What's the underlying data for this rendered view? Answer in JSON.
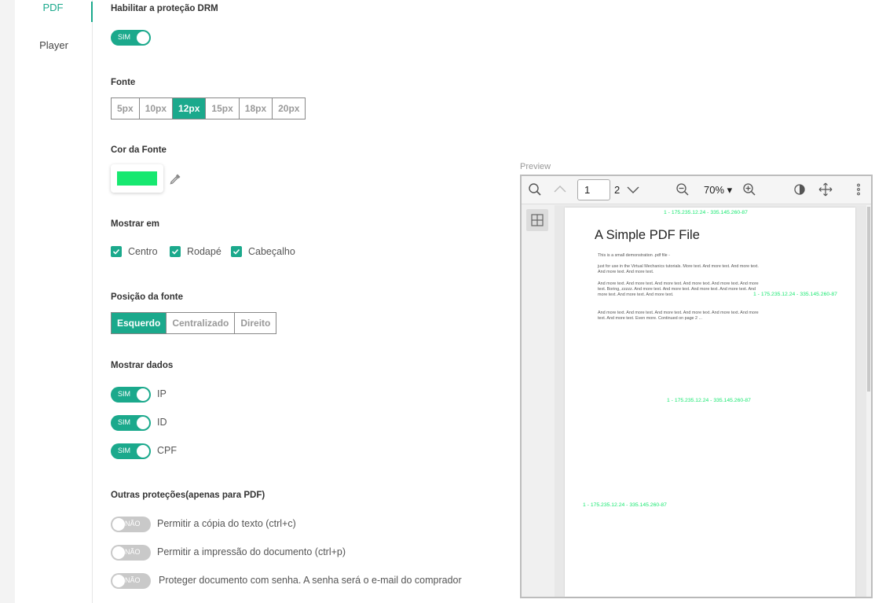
{
  "sidebar": {
    "tabs": [
      {
        "label": "PDF",
        "active": true
      },
      {
        "label": "Player",
        "active": false
      }
    ]
  },
  "drm": {
    "label": "Habilitar a proteção DRM",
    "toggle": "SIM"
  },
  "font_size": {
    "label": "Fonte",
    "options": [
      "5px",
      "10px",
      "12px",
      "15px",
      "18px",
      "20px"
    ],
    "selected": "12px"
  },
  "font_color": {
    "label": "Cor da Fonte",
    "value": "#17e870"
  },
  "show_in": {
    "label": "Mostrar em",
    "options": [
      "Centro",
      "Rodapé",
      "Cabeçalho"
    ]
  },
  "font_position": {
    "label": "Posição da fonte",
    "options": [
      "Esquerdo",
      "Centralizado",
      "Direito"
    ],
    "selected": "Esquerdo"
  },
  "show_data": {
    "label": "Mostrar dados",
    "items": [
      {
        "toggle": "SIM",
        "label": "IP"
      },
      {
        "toggle": "SIM",
        "label": "ID"
      },
      {
        "toggle": "SIM",
        "label": "CPF"
      }
    ]
  },
  "other": {
    "label": "Outras proteções(apenas para PDF)",
    "items": [
      {
        "toggle": "NÃO",
        "label": "Permitir a cópia do texto (ctrl+c)"
      },
      {
        "toggle": "NÃO",
        "label": "Permitir a impressão do documento (ctrl+p)"
      },
      {
        "toggle": "NÃO",
        "label": "Proteger documento com senha. A senha será o e-mail do comprador"
      }
    ]
  },
  "preview": {
    "label": "Preview",
    "page_current": "1",
    "page_total": "2",
    "zoom": "70%",
    "doc": {
      "title": "A Simple PDF File",
      "p1": "This is a small demonstration .pdf file -",
      "p2": "just for use in the Virtual Mechanics tutorials. More text. And more text. And more text. And more text. And more text.",
      "p3": "And more text. And more text. And more text. And more text. And more text. And more text. Boring, zzzzz. And more text. And more text. And more text. And more text. And more text. And more text. And more text.",
      "p4": "And more text. And more text. And more text. And more text. And more text. And more text. And more text. Even more. Continued on page 2 ...",
      "watermark": "1 - 175.235.12.24 - 335.145.260-87"
    }
  }
}
